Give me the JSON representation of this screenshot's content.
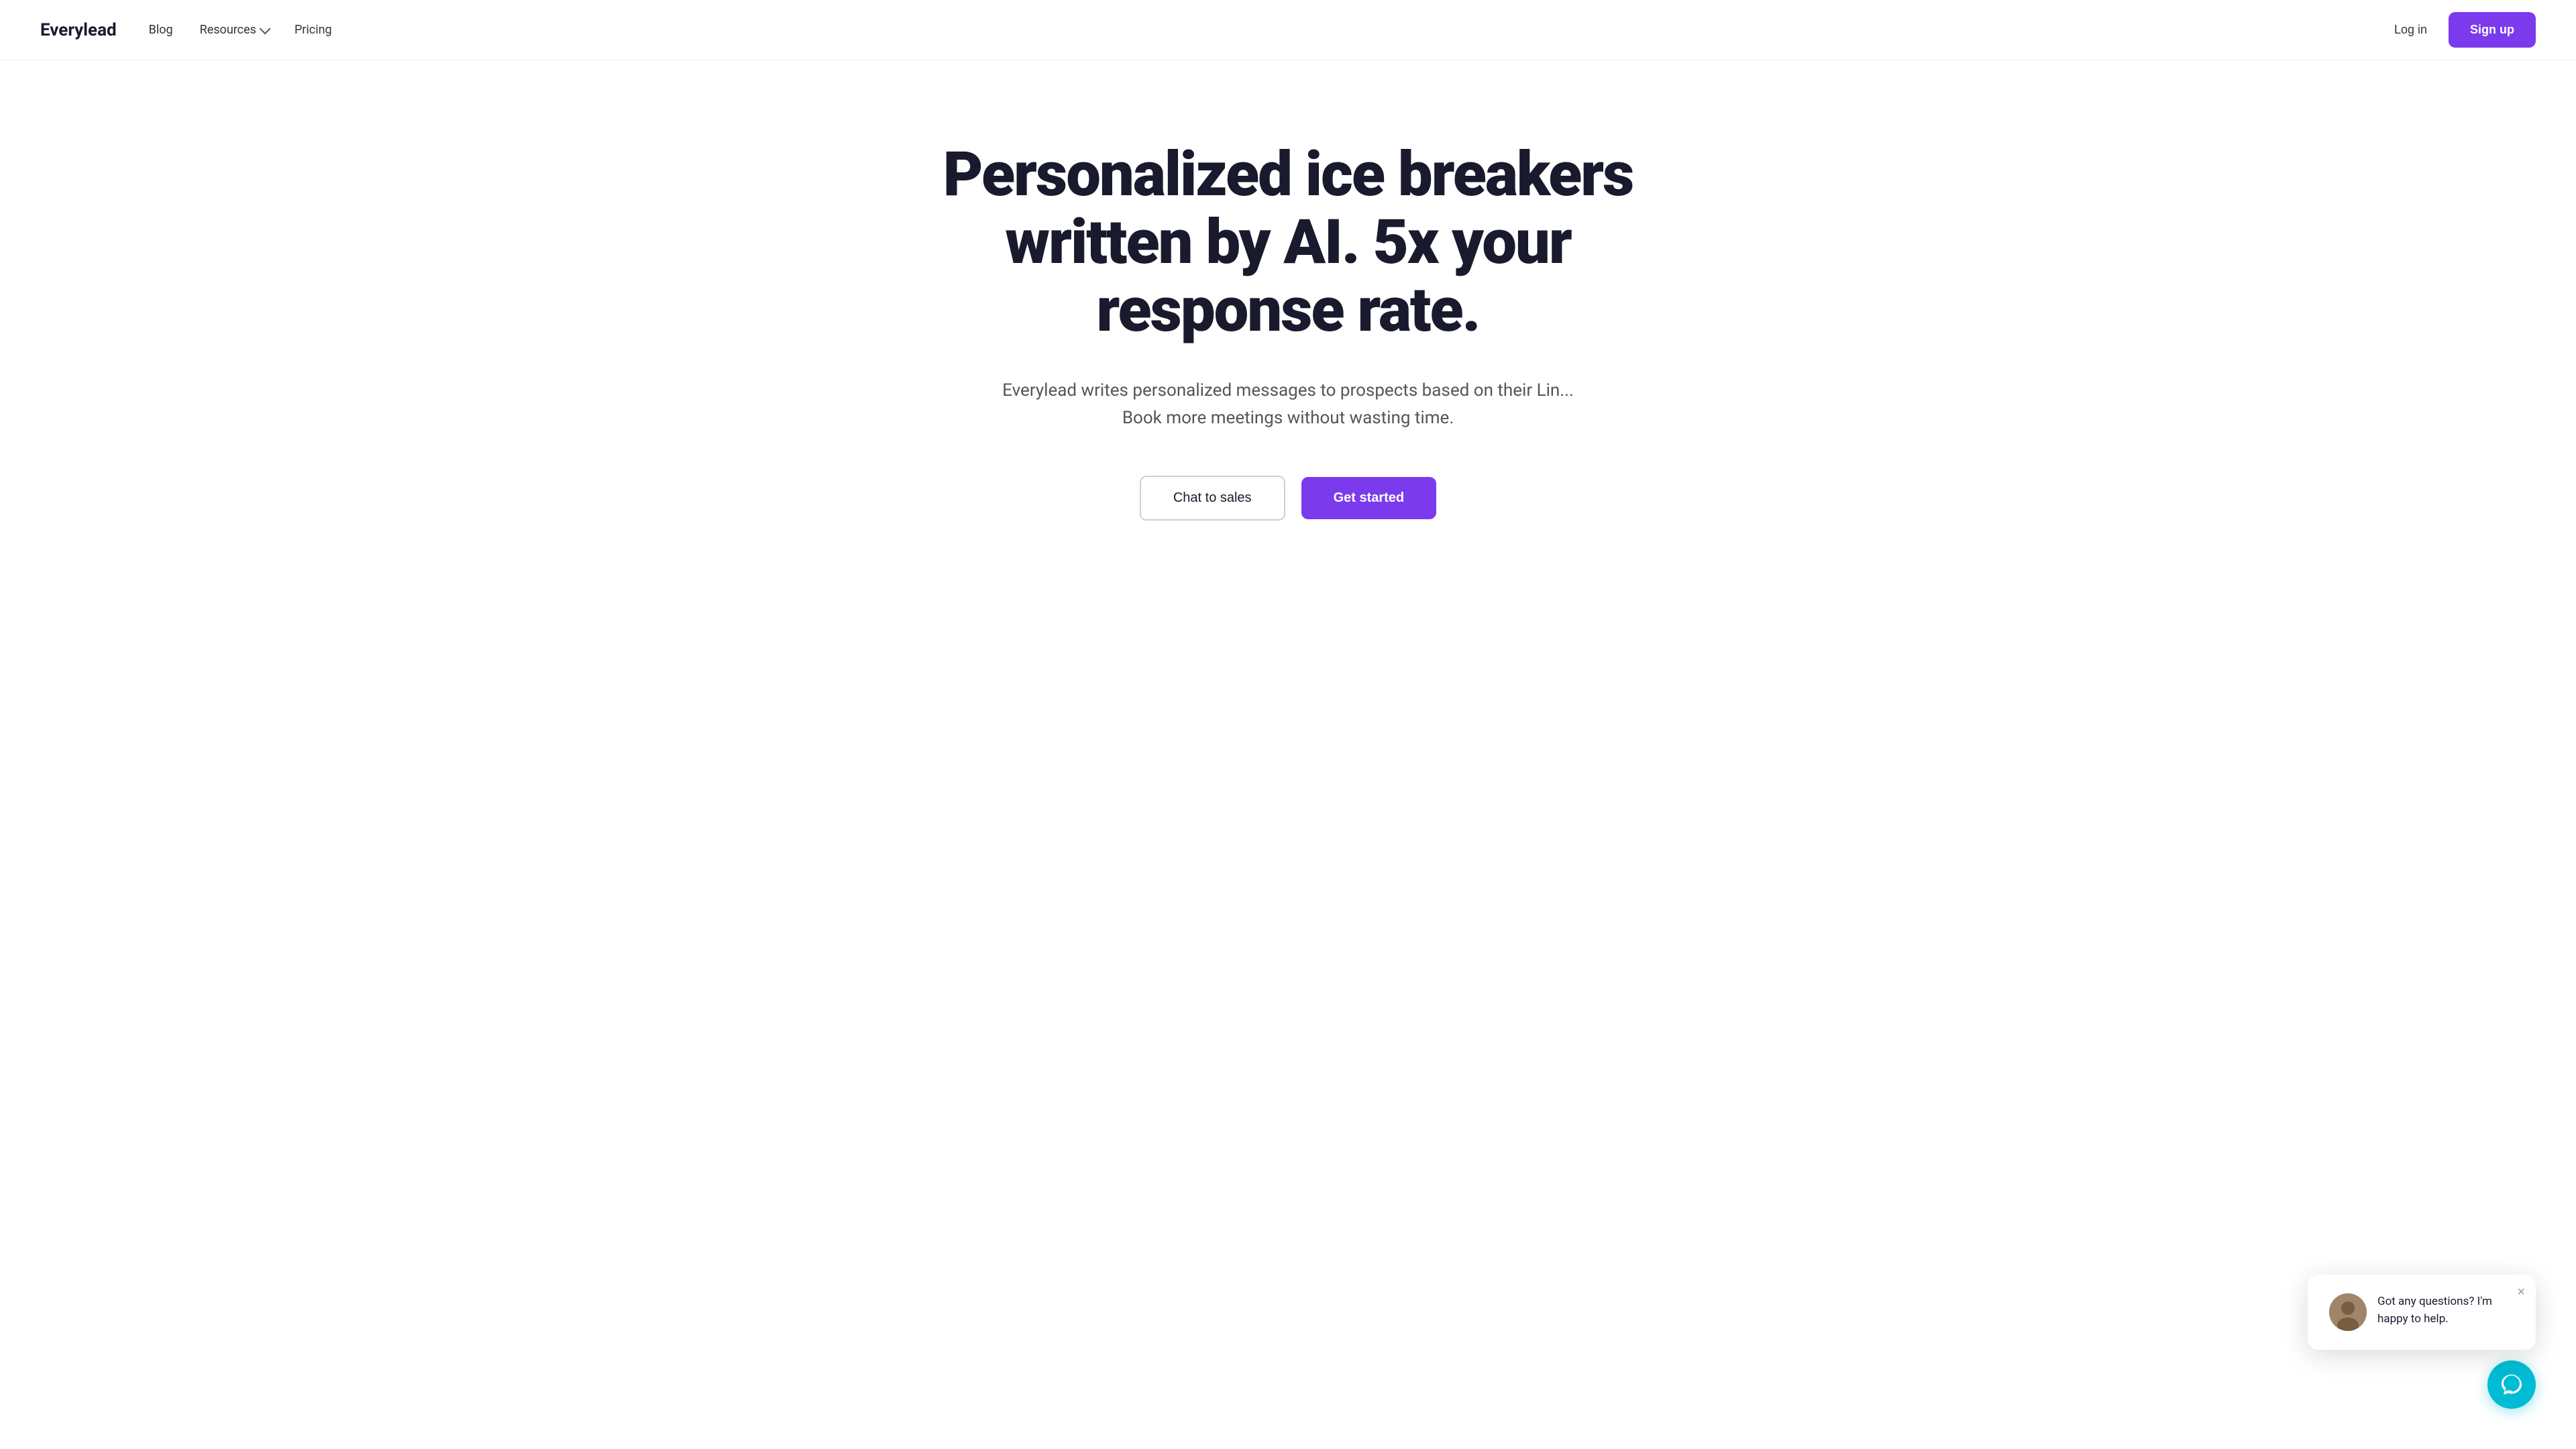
{
  "nav": {
    "logo": "Everylead",
    "links": [
      {
        "label": "Blog",
        "id": "blog"
      },
      {
        "label": "Resources",
        "id": "resources",
        "hasDropdown": true
      },
      {
        "label": "Pricing",
        "id": "pricing"
      }
    ],
    "login_label": "Log in",
    "signup_label": "Sign up"
  },
  "hero": {
    "title_line1": "Personalized ice breakers",
    "title_line2": "written by AI. 5x your",
    "title_line3": "response rate.",
    "subtitle": "Everylead writes personalized messages to prospects based on their Lin... Book more meetings without wasting time.",
    "btn_chat": "Chat to sales",
    "btn_get_started": "Get started"
  },
  "chat_widget": {
    "popup_text": "Got any questions? I'm happy to help.",
    "close_label": "×",
    "avatar_emoji": "👤"
  },
  "colors": {
    "accent": "#7c3aed",
    "chat_bg": "#00bcd4",
    "nav_text": "#1a1a2e"
  }
}
